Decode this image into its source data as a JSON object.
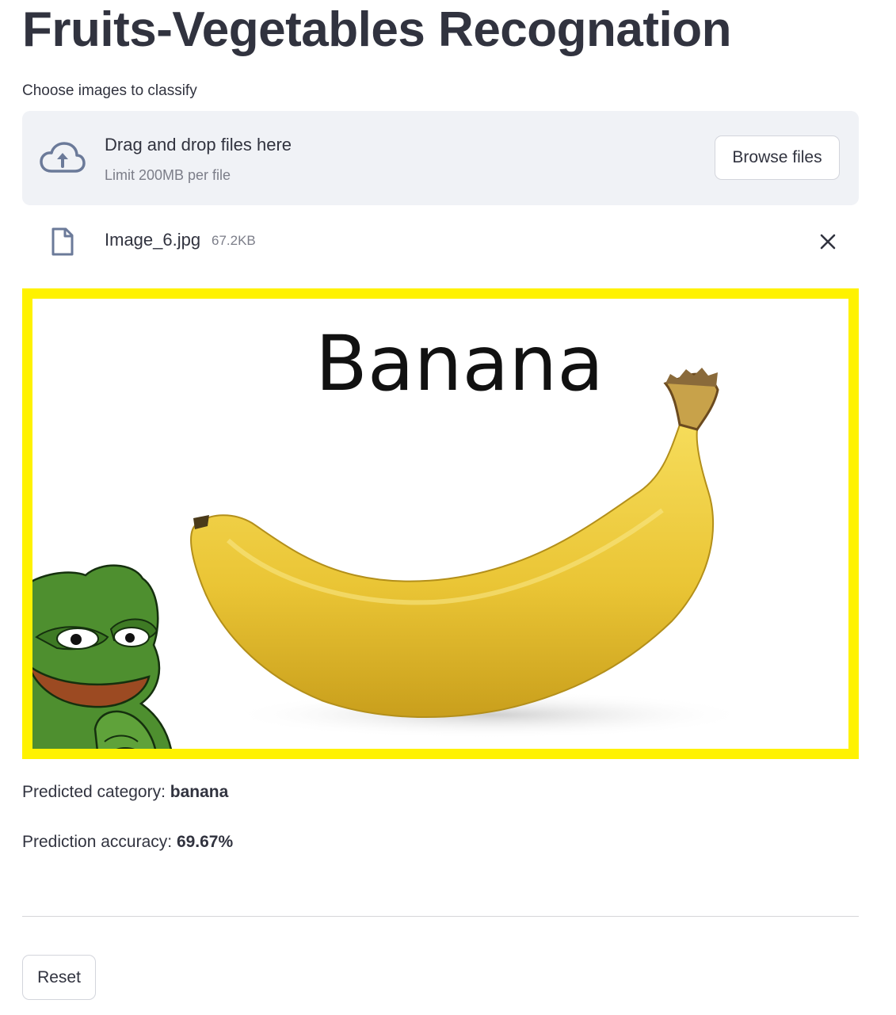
{
  "page": {
    "title": "Fruits-Vegetables Recognation"
  },
  "uploader": {
    "label": "Choose images to classify",
    "dropzone_text": "Drag and drop files here",
    "limit_text": "Limit 200MB per file",
    "browse_label": "Browse files",
    "icon": "cloud-upload-icon"
  },
  "uploaded_file": {
    "name": "Image_6.jpg",
    "size": "67.2KB",
    "icon": "file-icon",
    "remove_icon": "close-icon"
  },
  "image": {
    "caption_text": "Banana",
    "border_color": "#fff200"
  },
  "prediction": {
    "category_label": "Predicted category:",
    "category_value": "banana",
    "accuracy_label": "Prediction accuracy:",
    "accuracy_value": "69.67%"
  },
  "actions": {
    "reset_label": "Reset"
  }
}
